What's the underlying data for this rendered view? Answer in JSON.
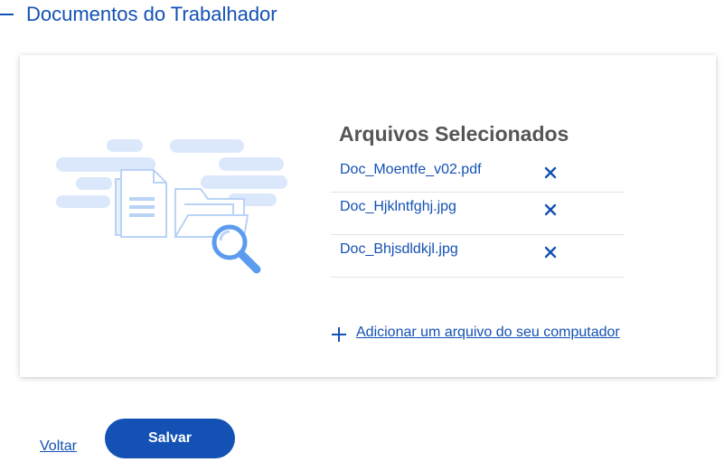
{
  "section": {
    "title": "Documentos do Trabalhador",
    "collapse_icon": "minus-icon"
  },
  "files_panel": {
    "title": "Arquivos Selecionados",
    "files": [
      {
        "name": "Doc_Moentfe_v02.pdf",
        "remove_icon": "close-icon"
      },
      {
        "name": "Doc_Hjklntfghj.jpg",
        "remove_icon": "close-icon"
      },
      {
        "name": "Doc_Bhjsdldkjl.jpg",
        "remove_icon": "close-icon"
      }
    ],
    "add_file_label": "Adicionar um arquivo do seu computador",
    "add_icon": "plus-icon"
  },
  "illustration": {
    "icon": "document-search-illustration"
  },
  "actions": {
    "back_label": "Voltar",
    "save_label": "Salvar"
  },
  "colors": {
    "primary": "#1351b4",
    "title_gray": "#555555",
    "illustration_light": "#dbe8fb",
    "illustration_mid": "#b9d3f7",
    "illustration_accent": "#5b9cf0"
  }
}
